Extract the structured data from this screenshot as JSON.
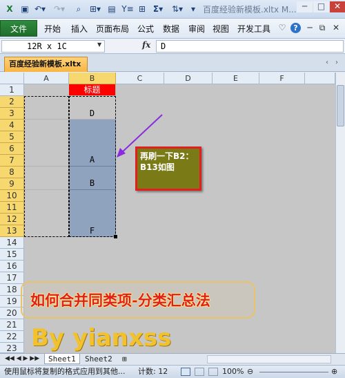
{
  "window": {
    "title": "百度经验新模板.xltx M...",
    "min_icon": "minimize-icon",
    "max_icon": "maximize-icon",
    "close_icon": "close-icon"
  },
  "quick_access": [
    "save-icon",
    "undo-icon",
    "redo-icon",
    "print-preview-icon",
    "border-icon",
    "paste-special-icon",
    "filter-icon",
    "grid-icon",
    "sum-icon",
    "align-icon",
    "customize-icon"
  ],
  "ribbon": {
    "file_tab": "文件",
    "tabs": [
      "开始",
      "插入",
      "页面布局",
      "公式",
      "数据",
      "审阅",
      "视图",
      "开发工具"
    ]
  },
  "formula_bar": {
    "name_box": "12R x 1C",
    "fx_label": "fx",
    "content": "D"
  },
  "doc_tab": "百度经验新模板.xltx",
  "columns": [
    "A",
    "B",
    "C",
    "D",
    "E",
    "F"
  ],
  "rows": [
    "1",
    "2",
    "3",
    "4",
    "5",
    "6",
    "7",
    "8",
    "9",
    "10",
    "11",
    "12",
    "13",
    "14",
    "15",
    "16",
    "17",
    "18",
    "19",
    "20",
    "21",
    "22",
    "23"
  ],
  "cells": {
    "B1": "标题",
    "B3": "D",
    "B7": "A",
    "B9": "B",
    "B13": "F"
  },
  "callout": "再刷一下B2：B13如图",
  "overlay_title": "如何合并同类项-分类汇总法",
  "overlay_by": "By yianxss",
  "sheets": [
    "Sheet1",
    "Sheet2"
  ],
  "status": {
    "message": "使用鼠标将复制的格式应用到其他...",
    "count": "计数: 12",
    "zoom": "100%"
  },
  "colors": {
    "header_red": "#ff0000",
    "selection_blue": "#8fa3bf",
    "callout_olive": "#7a7a17",
    "callout_border": "#e02020"
  }
}
